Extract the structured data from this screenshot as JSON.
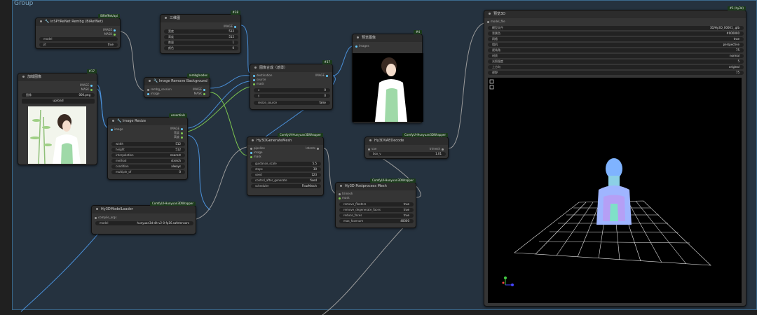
{
  "group": {
    "title": "Group"
  },
  "nodes": {
    "bg_remove": {
      "title": "🔧 inSPYReNet Rembg (BiRefNet)",
      "badge": "BiRefNet/api",
      "out_image": "IMAGE",
      "out_mask": "MASK",
      "w1_label": "model",
      "w1_value": "",
      "w2_label": "jit",
      "w2_value": "true"
    },
    "load_image": {
      "title": "加载图像",
      "badge": "#17",
      "out_image": "IMAGE",
      "out_mask": "MASK",
      "w_label": "图像",
      "w_value": "000.png",
      "upload": "upload"
    },
    "preview_top": {
      "title": "三维图",
      "badge": "#38",
      "out": "IMAGE",
      "rows": [
        {
          "l": "宽度",
          "v": "512"
        },
        {
          "l": "高度",
          "v": "512"
        },
        {
          "l": "数量",
          "v": "1"
        },
        {
          "l": "颜色",
          "v": "0"
        }
      ]
    },
    "image_remove_bg": {
      "title": "🔧 Image Remove Background",
      "badge": "rembg/nodes",
      "in_image": "image",
      "in_model": "rembg_session",
      "out_image": "IMAGE",
      "out_mask": "MASK"
    },
    "image_resize": {
      "title": "🔧 Image Resize",
      "badge": "essentials",
      "in": "image",
      "outs": [
        "IMAGE",
        "宽度",
        "高度"
      ],
      "rows": [
        {
          "l": "width",
          "v": "512"
        },
        {
          "l": "height",
          "v": "512"
        },
        {
          "l": "interpolation",
          "v": "nearest"
        },
        {
          "l": "method",
          "v": "stretch"
        },
        {
          "l": "condition",
          "v": "always"
        },
        {
          "l": "multiple_of",
          "v": "0"
        }
      ]
    },
    "image_compose": {
      "title": "图像合成（遮罩）",
      "badge": "#37",
      "ins": [
        "destination",
        "source",
        "mask"
      ],
      "out": "IMAGE",
      "rows": [
        {
          "l": "x",
          "v": "0"
        },
        {
          "l": "y",
          "v": "0"
        }
      ],
      "toggle_l": "resize_source",
      "toggle_v": "false"
    },
    "preview_img": {
      "title": "预览图像",
      "badge": "#4",
      "in": "images"
    },
    "hy3d_model_loader": {
      "title": "Hy3DModelLoader",
      "badge": "ComfyUI-Hunyuan3DWrapper",
      "in": "compile_args",
      "w_label": "model",
      "w_value": "hunyuan3d-dit-v2-0-fp16.safetensors"
    },
    "hy3d_generate": {
      "title": "Hy3DGenerateMesh",
      "badge": "ComfyUI-Hunyuan3DWrapper",
      "ins": [
        "pipeline",
        "image",
        "mask"
      ],
      "out": "latents",
      "rows": [
        {
          "l": "guidance_scale",
          "v": "5.5"
        },
        {
          "l": "steps",
          "v": "30"
        },
        {
          "l": "seed",
          "v": "123"
        },
        {
          "l": "control_after_generate",
          "v": "fixed"
        },
        {
          "l": "scheduler",
          "v": "FlowMatch"
        }
      ]
    },
    "hy3d_vae": {
      "title": "Hy3DVAEDecode",
      "badge": "ComfyUI-Hunyuan3DWrapper",
      "ins": [
        "vae",
        "latents"
      ],
      "out": "trimesh",
      "rows": [
        {
          "l": "box_v",
          "v": "1.01"
        },
        {
          "l": "octree_resolution",
          "v": "384"
        }
      ]
    },
    "hy3d_postprocess": {
      "title": "Hy3D Postprocess Mesh",
      "badge": "ComfyUI-Hunyuan3DWrapper",
      "ins": [
        "trimesh",
        "mask"
      ],
      "rows": [
        {
          "l": "remove_floaters",
          "v": "true"
        },
        {
          "l": "remove_degenerate_faces",
          "v": "true"
        },
        {
          "l": "reduce_faces",
          "v": "true"
        },
        {
          "l": "max_facenum",
          "v": "40000"
        }
      ]
    },
    "preview3d": {
      "title": "预览3D",
      "in": "model_file",
      "rows": [
        {
          "l": "模型文件",
          "v": "3D/Hy3D_00001_.glb"
        },
        {
          "l": "背景色",
          "v": "#000000"
        },
        {
          "l": "网格",
          "v": "true"
        },
        {
          "l": "相机",
          "v": "perspective"
        },
        {
          "l": "视场角",
          "v": "75"
        },
        {
          "l": "材质",
          "v": "normal"
        },
        {
          "l": "光照强度",
          "v": "5"
        },
        {
          "l": "上方向",
          "v": "original"
        },
        {
          "l": "视野",
          "v": "75"
        }
      ],
      "badge": "#1 (hy3d)"
    }
  },
  "colors": {
    "link_blue": "#4a90d9",
    "link_green": "#7ec850",
    "link_grey": "#9a9a9a",
    "group_border": "#3b6a8d"
  }
}
